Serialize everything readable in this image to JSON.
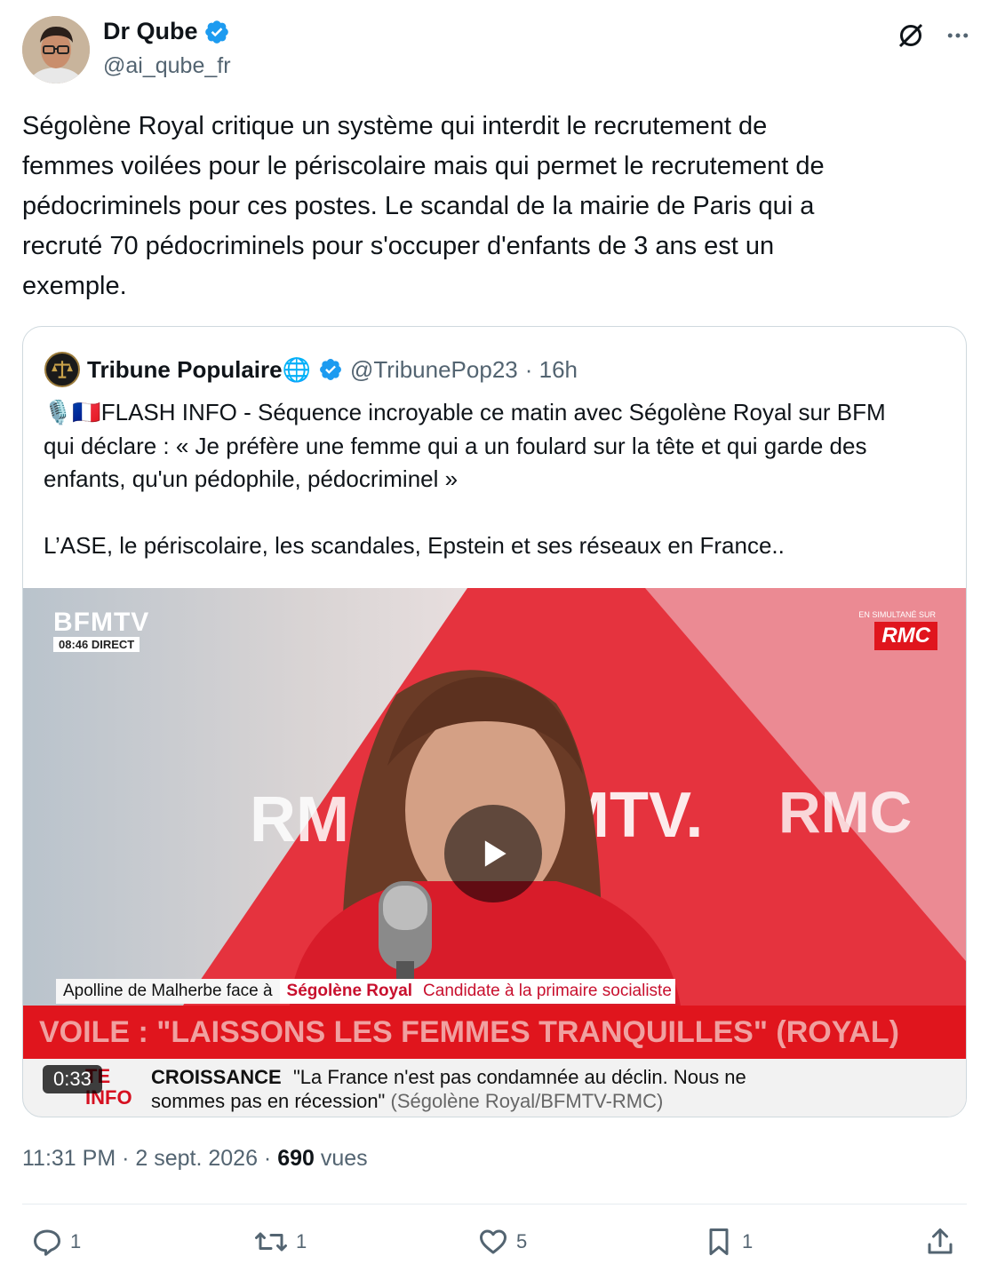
{
  "author": {
    "name": "Dr Qube",
    "handle": "@ai_qube_fr"
  },
  "tweet": {
    "text": "Ségolène Royal critique un système qui interdit le recrutement de\nfemmes voilées pour le périscolaire mais qui permet le recrutement de\npédocriminels pour ces postes. Le scandal de la mairie de Paris qui a\nrecruté 70 pédocriminels pour s'occuper d'enfants de 3 ans est un\nexemple."
  },
  "quoted": {
    "name": "Tribune Populaire🌐",
    "handle": "@TribunePop23",
    "time": "· 16h",
    "text": "🎙️🇫🇷FLASH INFO - Séquence incroyable ce matin avec Ségolène Royal sur BFM\nqui déclare : « Je préfère une femme qui a un foulard sur la tête et qui garde des\nenfants, qu'un pédophile, pédocriminel »\n\nL’ASE, le périscolaire, les scandales, Epstein et ses réseaux en France..",
    "video": {
      "duration": "0:33",
      "channel_logo": "BFMTV",
      "channel_time": "08:46  DIRECT",
      "rmc_label": "RMC",
      "rmc_small": "EN SIMULTANÉ SUR",
      "bg_rmc_left": "RM",
      "bg_bfmtv": "MTV.",
      "bg_rmc_right": "RMC",
      "lower_third_host": "Apolline de Malherbe face à",
      "lower_third_guest": "Ségolène Royal",
      "lower_third_role": "Candidate à la primaire socialiste",
      "headline": "VOILE : \"LAISSONS LES FEMMES TRANQUILLES\" (ROYAL)",
      "ticker_tag": "TE\nINFO",
      "ticker_title": "CROISSANCE",
      "ticker_quote": "\"La France n'est pas condamnée au déclin. Nous ne",
      "ticker_line2": "sommes pas en récession\"",
      "ticker_source": " (Ségolène Royal/BFMTV-RMC)"
    }
  },
  "meta": {
    "time": "11:31 PM · 2 sept. 2026 · ",
    "views_count": "690",
    "views_label": " vues"
  },
  "actions": {
    "reply_count": "1",
    "retweet_count": "1",
    "like_count": "5",
    "bookmark_count": "1"
  },
  "icons": [
    "grok-icon",
    "more-icon",
    "verified-icon",
    "reply-icon",
    "retweet-icon",
    "like-icon",
    "bookmark-icon",
    "share-icon",
    "play-icon",
    "globe-icon"
  ],
  "colors": {
    "verified_blue": "#1d9bf0",
    "secondary_text": "#536471",
    "bfm_red": "#e0151d"
  }
}
